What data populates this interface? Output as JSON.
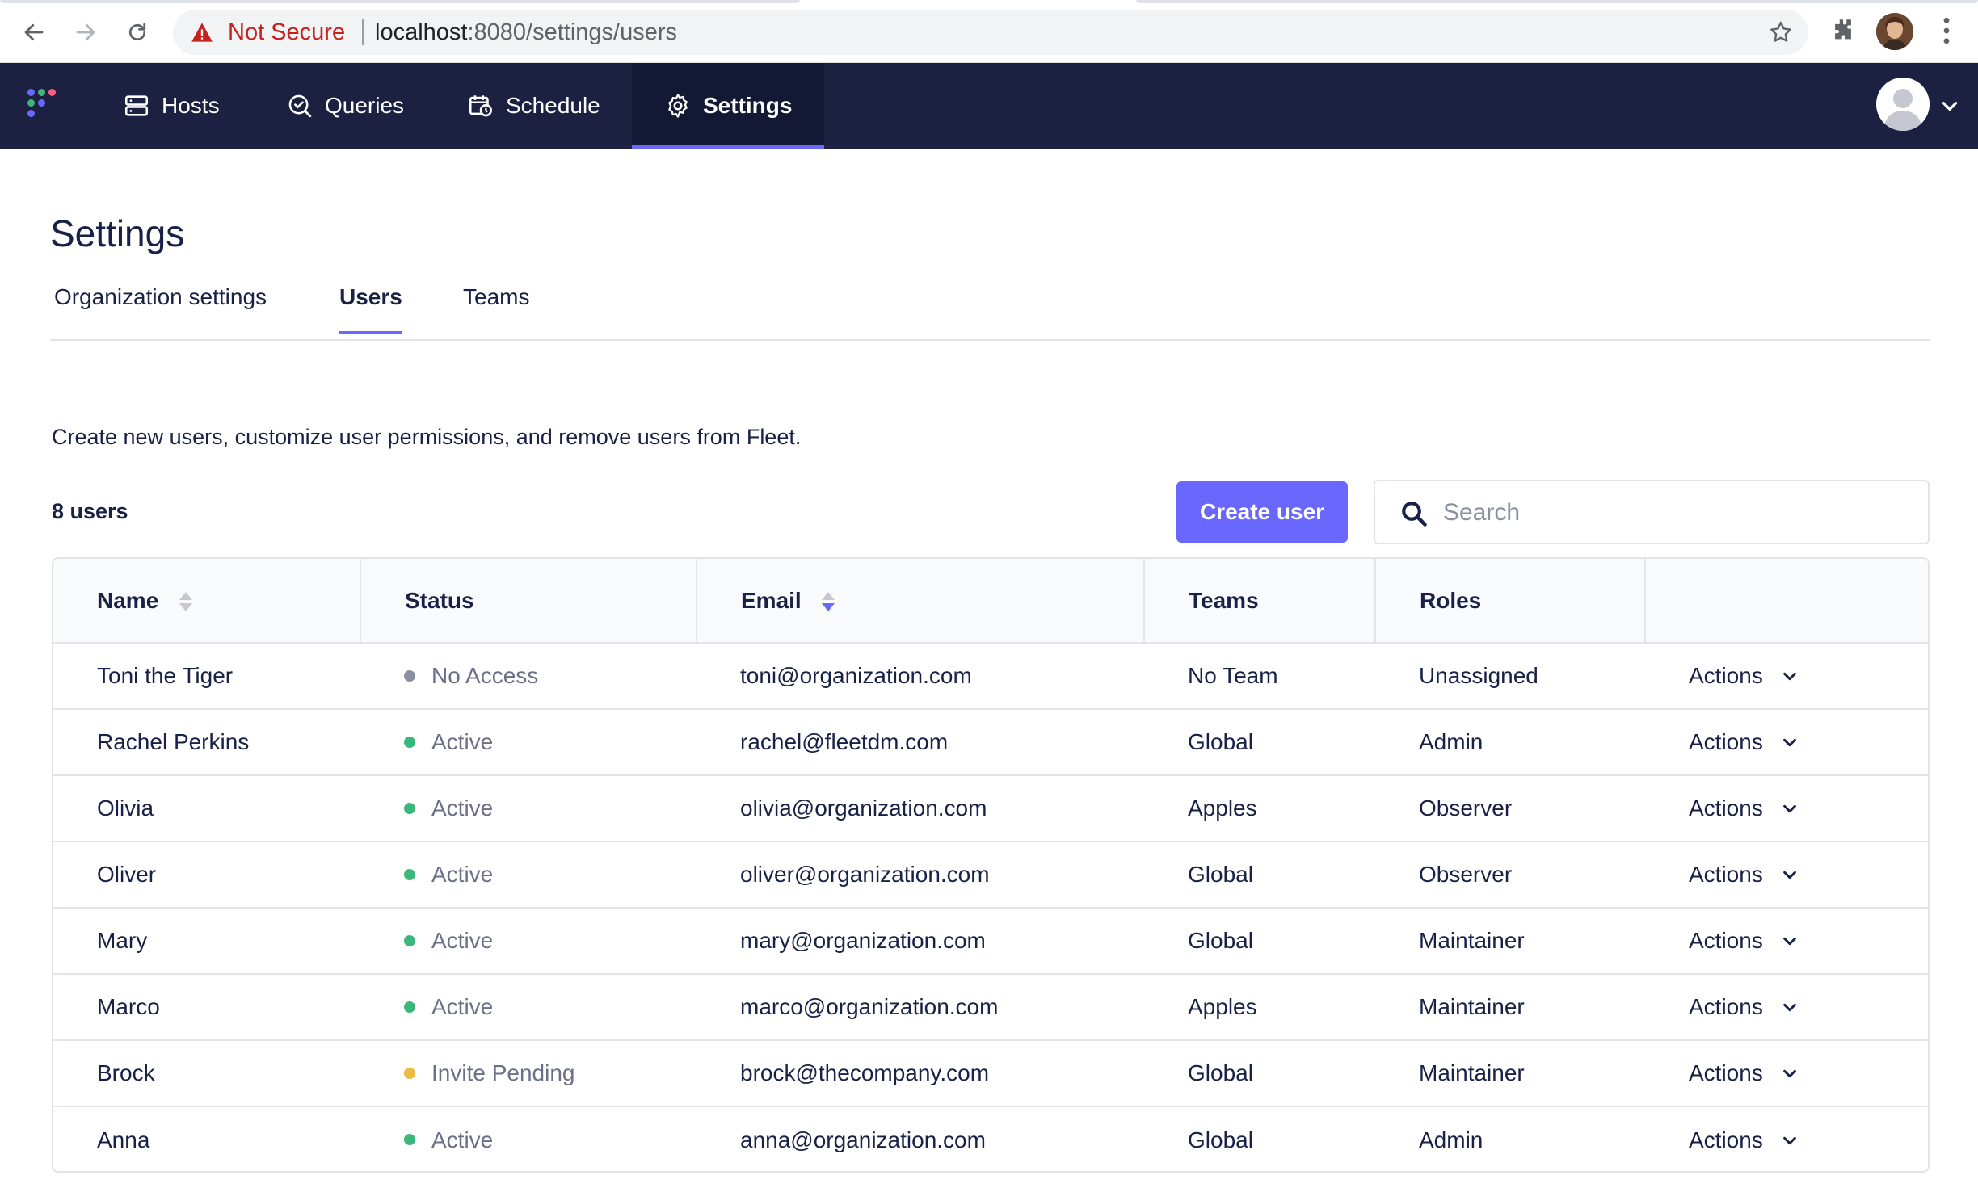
{
  "browser": {
    "security_label": "Not Secure",
    "url_host": "localhost",
    "url_path": ":8080/settings/users"
  },
  "nav": {
    "items": [
      {
        "label": "Hosts",
        "icon": "hosts-icon"
      },
      {
        "label": "Queries",
        "icon": "queries-icon"
      },
      {
        "label": "Schedule",
        "icon": "schedule-icon"
      },
      {
        "label": "Settings",
        "icon": "gear-icon",
        "active": true
      }
    ]
  },
  "page": {
    "title": "Settings",
    "tabs": [
      {
        "label": "Organization settings"
      },
      {
        "label": "Users",
        "active": true
      },
      {
        "label": "Teams"
      }
    ],
    "description": "Create new users, customize user permissions, and remove users from Fleet.",
    "user_count": "8 users",
    "create_button": "Create user",
    "search_placeholder": "Search"
  },
  "table": {
    "columns": [
      "Name",
      "Status",
      "Email",
      "Teams",
      "Roles",
      ""
    ],
    "action_label": "Actions",
    "rows": [
      {
        "name": "Toni the Tiger",
        "status": "No Access",
        "status_color": "#8b8fa2",
        "email": "toni@organization.com",
        "teams": "No Team",
        "roles": "Unassigned"
      },
      {
        "name": "Rachel Perkins",
        "status": "Active",
        "status_color": "#3db67b",
        "email": "rachel@fleetdm.com",
        "teams": "Global",
        "roles": "Admin"
      },
      {
        "name": "Olivia",
        "status": "Active",
        "status_color": "#3db67b",
        "email": "olivia@organization.com",
        "teams": "Apples",
        "roles": "Observer"
      },
      {
        "name": "Oliver",
        "status": "Active",
        "status_color": "#3db67b",
        "email": "oliver@organization.com",
        "teams": "Global",
        "roles": "Observer"
      },
      {
        "name": "Mary",
        "status": "Active",
        "status_color": "#3db67b",
        "email": "mary@organization.com",
        "teams": "Global",
        "roles": "Maintainer"
      },
      {
        "name": "Marco",
        "status": "Active",
        "status_color": "#3db67b",
        "email": "marco@organization.com",
        "teams": "Apples",
        "roles": "Maintainer"
      },
      {
        "name": "Brock",
        "status": "Invite Pending",
        "status_color": "#ebbc43",
        "email": "brock@thecompany.com",
        "teams": "Global",
        "roles": "Maintainer"
      },
      {
        "name": "Anna",
        "status": "Active",
        "status_color": "#3db67b",
        "email": "anna@organization.com",
        "teams": "Global",
        "roles": "Admin"
      }
    ]
  },
  "colors": {
    "nav_bg": "#1c2141",
    "accent": "#6a67fe",
    "text": "#192147"
  }
}
